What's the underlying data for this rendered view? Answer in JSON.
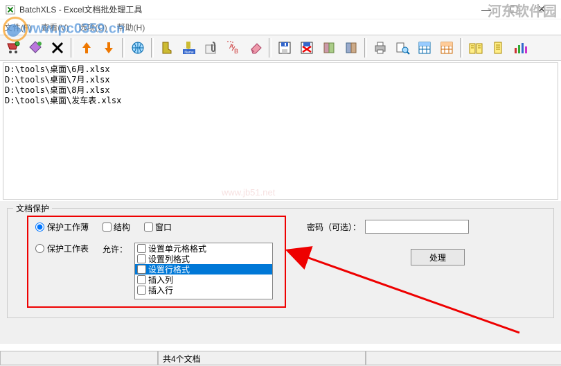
{
  "title": "BatchXLS - Excel文档批处理工具",
  "menu": {
    "file": "文件(F)",
    "view": "查看(V)",
    "options": "选项(O)",
    "help": "帮助(H)"
  },
  "watermark": "www.pc0359.cn",
  "wmtext": "河东软件园",
  "wmurl": "www.jb51.net",
  "files": [
    "D:\\tools\\桌面\\6月.xlsx",
    "D:\\tools\\桌面\\7月.xlsx",
    "D:\\tools\\桌面\\8月.xlsx",
    "D:\\tools\\桌面\\发车表.xlsx"
  ],
  "group": {
    "legend": "文档保护"
  },
  "protect": {
    "workbook": "保护工作薄",
    "structure": "结构",
    "windows": "窗口",
    "worksheet": "保护工作表",
    "allow": "允许：",
    "options": [
      "设置单元格格式",
      "设置列格式",
      "设置行格式",
      "插入列",
      "插入行"
    ]
  },
  "password": {
    "label": "密码（可选）：",
    "process": "处理"
  },
  "status": {
    "docs": "共4个文档"
  }
}
